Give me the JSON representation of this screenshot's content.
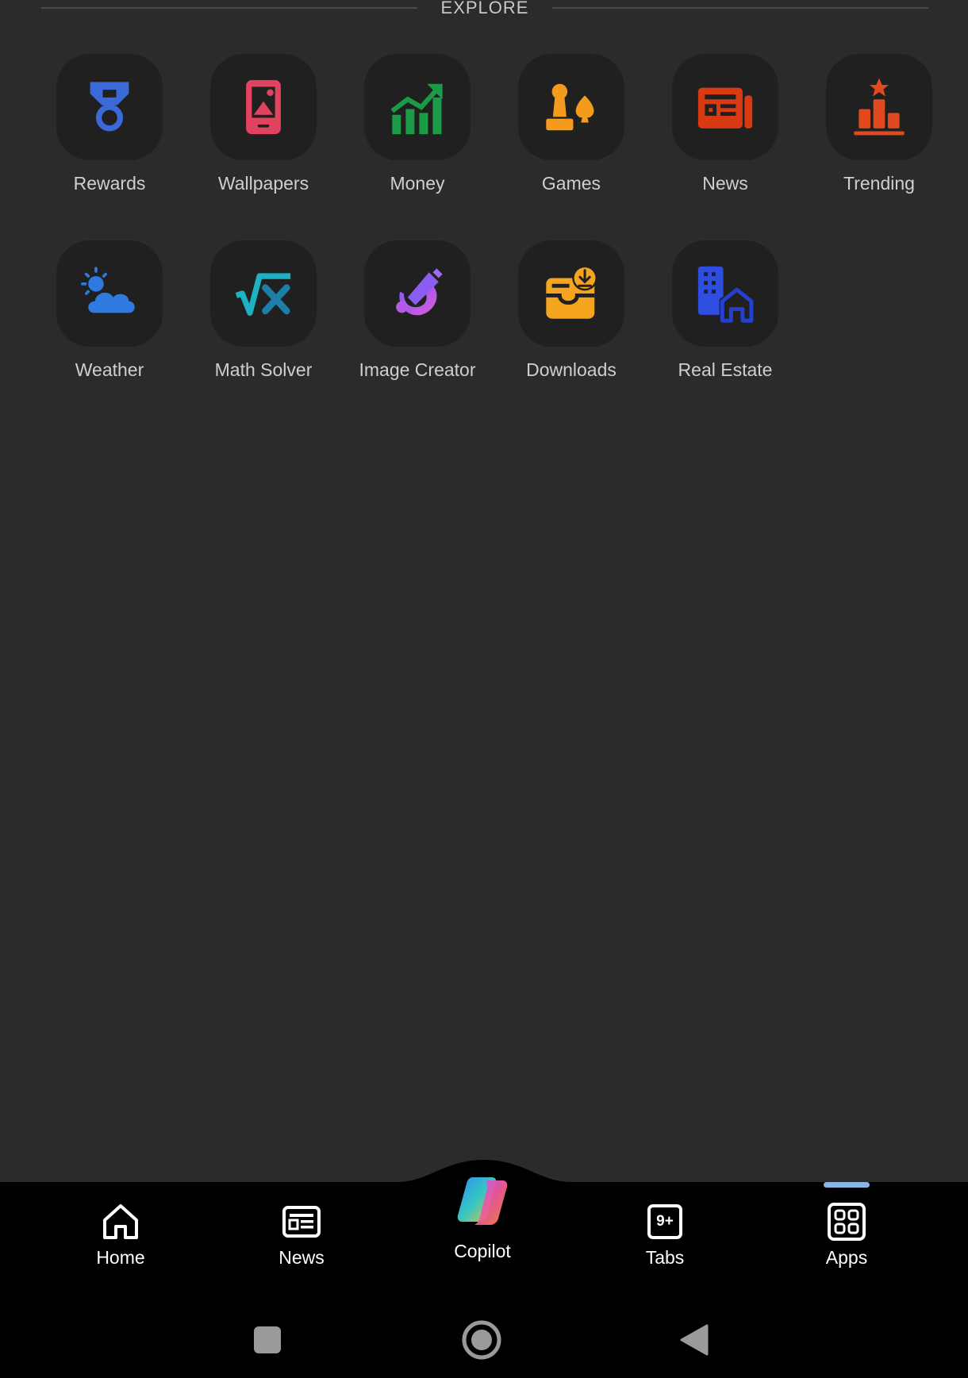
{
  "explore": {
    "title": "EXPLORE"
  },
  "apps": [
    {
      "label": "Rewards",
      "icon": "medal-icon",
      "color": "#3a6ad8"
    },
    {
      "label": "Wallpapers",
      "icon": "phone-image-icon",
      "color": "#e0435d"
    },
    {
      "label": "Money",
      "icon": "chart-growth-icon",
      "color": "#1c9b46"
    },
    {
      "label": "Games",
      "icon": "game-pieces-icon",
      "color": "#f59b1c"
    },
    {
      "label": "News",
      "icon": "newspaper-icon",
      "color": "#d93a12"
    },
    {
      "label": "Trending",
      "icon": "podium-star-icon",
      "color": "#e04a1e"
    },
    {
      "label": "Weather",
      "icon": "sun-cloud-icon",
      "color": "#2f7ae0"
    },
    {
      "label": "Math Solver",
      "icon": "sqrt-x-icon",
      "color": "#1fb0c2"
    },
    {
      "label": "Image Creator",
      "icon": "paintbrush-icon",
      "color": "#b04cf0"
    },
    {
      "label": "Downloads",
      "icon": "download-tray-icon",
      "color": "#f5a41e"
    },
    {
      "label": "Real Estate",
      "icon": "building-house-icon",
      "color": "#2e4ee0"
    }
  ],
  "bottom_nav": {
    "home": "Home",
    "news": "News",
    "copilot": "Copilot",
    "tabs": "Tabs",
    "tabs_count": "9+",
    "apps": "Apps",
    "active": "Apps",
    "indicator_color": "#8ab4e8"
  }
}
